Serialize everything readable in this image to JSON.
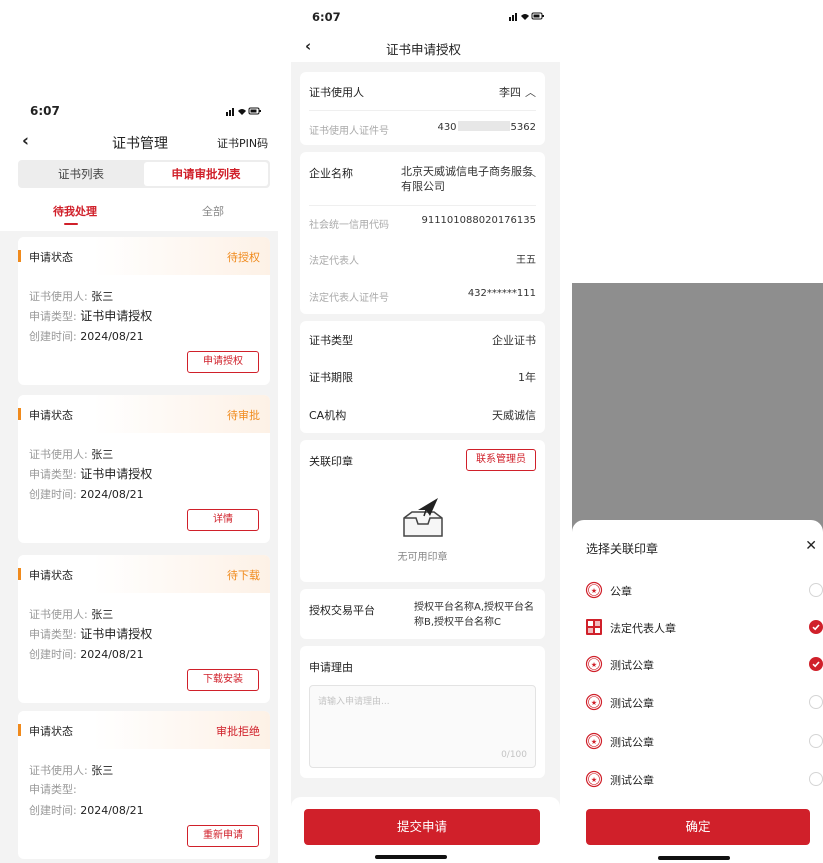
{
  "colors": {
    "accent": "#d0202a",
    "status_bar": "#f08a1c",
    "overlay": "#8e8e8e"
  },
  "screen1": {
    "time": "6:07",
    "status_icons": "signal-wifi-battery",
    "title": "证书管理",
    "pin_link": "证书PIN码",
    "tabs": [
      "证书列表",
      "申请审批列表"
    ],
    "subtabs": [
      "待我处理",
      "全部"
    ],
    "cards": [
      {
        "title": "申请状态",
        "status": "待授权",
        "user_label": "证书使用人:",
        "user": "张三",
        "type_label": "申请类型:",
        "type": "证书申请授权",
        "time_label": "创建时间:",
        "time": "2024/08/21",
        "button": "申请授权"
      },
      {
        "title": "申请状态",
        "status": "待审批",
        "user_label": "证书使用人:",
        "user": "张三",
        "type_label": "申请类型:",
        "type": "证书申请授权",
        "time_label": "创建时间:",
        "time": "2024/08/21",
        "button": "详情"
      },
      {
        "title": "申请状态",
        "status": "待下载",
        "user_label": "证书使用人:",
        "user": "张三",
        "type_label": "申请类型:",
        "type": "证书申请授权",
        "time_label": "创建时间:",
        "time": "2024/08/21",
        "button": "下载安装"
      },
      {
        "title": "申请状态",
        "status": "审批拒绝",
        "user_label": "证书使用人:",
        "user": "张三",
        "type_label": "申请类型:",
        "type": "",
        "time_label": "创建时间:",
        "time": "2024/08/21",
        "button": "重新申请"
      }
    ]
  },
  "screen2": {
    "time": "6:07",
    "title": "证书申请授权",
    "cert_user_label": "证书使用人",
    "cert_user_value": "李四",
    "cert_id_label": "证书使用人证件号",
    "cert_id_prefix": "430",
    "cert_id_suffix": "5362",
    "company_label": "企业名称",
    "company_value": "北京天威诚信电子商务服务有限公司",
    "credit_code_label": "社会统一信用代码",
    "credit_code_value": "911101088020176135",
    "legal_rep_label": "法定代表人",
    "legal_rep_value": "王五",
    "legal_id_label": "法定代表人证件号",
    "legal_id_value": "432******111",
    "cert_type_label": "证书类型",
    "cert_type_value": "企业证书",
    "cert_period_label": "证书期限",
    "cert_period_value": "1年",
    "ca_label": "CA机构",
    "ca_value": "天威诚信",
    "seal_label": "关联印章",
    "contact_admin_button": "联系管理员",
    "no_seal_text": "无可用印章",
    "platform_label": "授权交易平台",
    "platform_value": "授权平台名称A,授权平台名称B,授权平台名称C",
    "reason_label": "申请理由",
    "reason_placeholder": "请输入申请理由...",
    "reason_count": "0/100",
    "submit_button": "提交申请"
  },
  "screen3": {
    "sheet_title": "选择关联印章",
    "close_icon": "close-icon",
    "seals": [
      {
        "label": "公章",
        "icon": "round-seal-icon",
        "selected": false
      },
      {
        "label": "法定代表人章",
        "icon": "square-seal-icon",
        "selected": true
      },
      {
        "label": "测试公章",
        "icon": "round-seal-icon",
        "selected": true
      },
      {
        "label": "测试公章",
        "icon": "round-seal-icon",
        "selected": false
      },
      {
        "label": "测试公章",
        "icon": "round-seal-icon",
        "selected": false
      },
      {
        "label": "测试公章",
        "icon": "round-seal-icon",
        "selected": false
      }
    ],
    "confirm_button": "确定"
  }
}
